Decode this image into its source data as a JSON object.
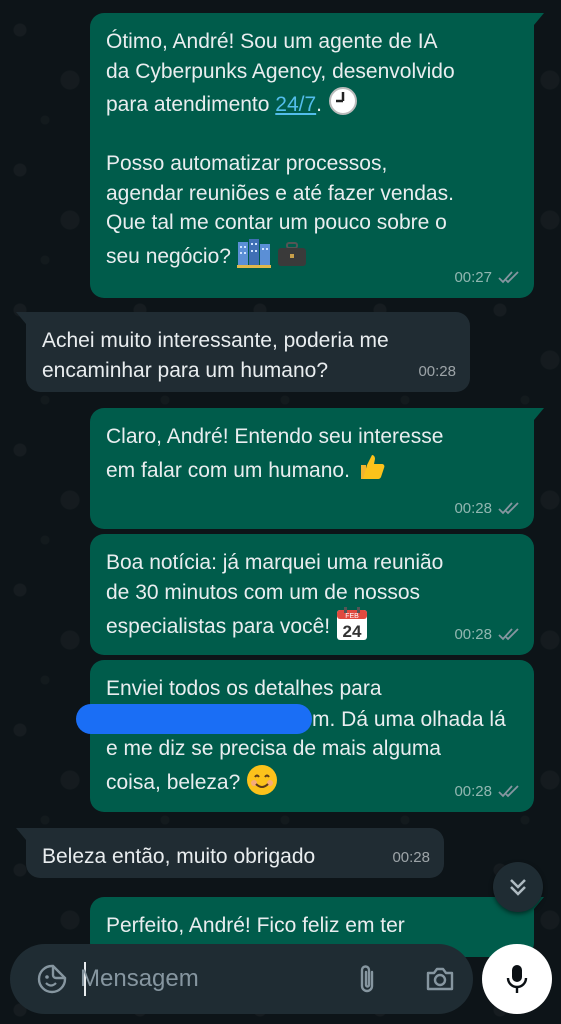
{
  "messages": [
    {
      "direction": "outgoing",
      "lines": [
        "Ótimo, André! Sou um agente de IA",
        "da Cyberpunks Agency, desenvolvido",
        "para atendimento ",
        "",
        "Posso automatizar processos,",
        "agendar reuniões e até fazer vendas.",
        "Que tal me contar um pouco sobre o",
        "seu negócio? "
      ],
      "link": "24/7",
      "time": "00:27",
      "emojis": [
        "clock-icon",
        "buildings-icon",
        "briefcase-icon"
      ]
    },
    {
      "direction": "incoming",
      "lines": [
        "Achei muito interessante, poderia me",
        "encaminhar para um humano?"
      ],
      "time": "00:28"
    },
    {
      "direction": "outgoing",
      "lines": [
        "Claro, André! Entendo seu interesse",
        "em falar com um humano. "
      ],
      "time": "00:28",
      "emojis": [
        "thumbs-up-icon"
      ]
    },
    {
      "direction": "outgoing",
      "lines": [
        "Boa notícia: já marquei uma reunião",
        "de 30 minutos com um de nossos",
        "especialistas para você! "
      ],
      "time": "00:28",
      "emojis": [
        "calendar-icon"
      ],
      "calendar": {
        "month": "FEB",
        "day": "24"
      }
    },
    {
      "direction": "outgoing",
      "lines": [
        "Enviei todos os detalhes para",
        "m. Dá uma olhada lá",
        "e me diz se precisa de mais alguma",
        "coisa, beleza? "
      ],
      "time": "00:28",
      "emojis": [
        "smiling-face-icon"
      ]
    },
    {
      "direction": "incoming",
      "lines": [
        "Beleza então, muito obrigado"
      ],
      "time": "00:28"
    },
    {
      "direction": "outgoing",
      "lines": [
        "Perfeito, André! Fico feliz em ter"
      ]
    }
  ],
  "input": {
    "placeholder": "Mensagem"
  },
  "colors": {
    "outgoing": "#005c4b",
    "incoming": "#202c33",
    "link": "#53bdeb",
    "ticks": "#8696a0"
  }
}
